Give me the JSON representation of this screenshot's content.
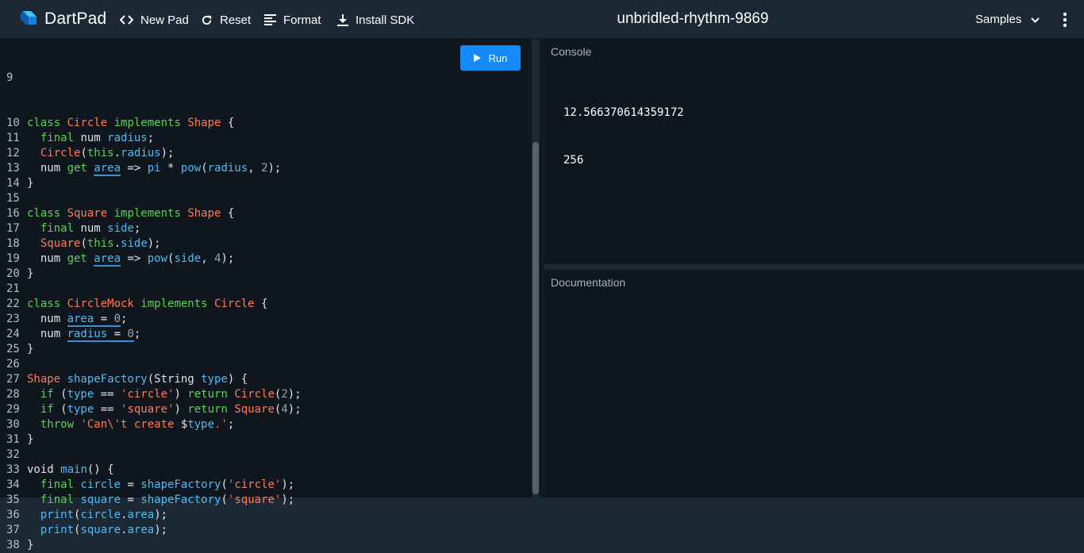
{
  "header": {
    "logo_text": "DartPad",
    "new_pad": "New Pad",
    "reset": "Reset",
    "format": "Format",
    "install_sdk": "Install SDK",
    "title": "unbridled-rhythm-9869",
    "samples": "Samples"
  },
  "editor": {
    "run_label": "Run",
    "first_line": "9",
    "lines": [
      {
        "n": "10",
        "t": [
          [
            "kw",
            "class "
          ],
          [
            "ty",
            "Circle"
          ],
          [
            "kw",
            " implements "
          ],
          [
            "ty",
            "Shape"
          ],
          [
            "pl",
            " {"
          ]
        ]
      },
      {
        "n": "11",
        "t": [
          [
            "pl",
            "  "
          ],
          [
            "kw",
            "final "
          ],
          [
            "pl",
            "num "
          ],
          [
            "fn",
            "radius"
          ],
          [
            "pl",
            ";"
          ]
        ]
      },
      {
        "n": "12",
        "t": [
          [
            "pl",
            "  "
          ],
          [
            "ty",
            "Circle"
          ],
          [
            "pl",
            "("
          ],
          [
            "kw",
            "this"
          ],
          [
            "pl",
            "."
          ],
          [
            "fn",
            "radius"
          ],
          [
            "pl",
            ");"
          ]
        ]
      },
      {
        "n": "13",
        "t": [
          [
            "pl",
            "  num "
          ],
          [
            "kw",
            "get "
          ],
          [
            "fn u",
            "area"
          ],
          [
            "pl",
            " => "
          ],
          [
            "fn",
            "pi"
          ],
          [
            "pl",
            " * "
          ],
          [
            "fn",
            "pow"
          ],
          [
            "pl",
            "("
          ],
          [
            "fn",
            "radius"
          ],
          [
            "pl",
            ", "
          ],
          [
            "nm",
            "2"
          ],
          [
            "pl",
            ");"
          ]
        ]
      },
      {
        "n": "14",
        "t": [
          [
            "pl",
            "}"
          ]
        ]
      },
      {
        "n": "15",
        "t": []
      },
      {
        "n": "16",
        "t": [
          [
            "kw",
            "class "
          ],
          [
            "ty",
            "Square"
          ],
          [
            "kw",
            " implements "
          ],
          [
            "ty",
            "Shape"
          ],
          [
            "pl",
            " {"
          ]
        ]
      },
      {
        "n": "17",
        "t": [
          [
            "pl",
            "  "
          ],
          [
            "kw",
            "final "
          ],
          [
            "pl",
            "num "
          ],
          [
            "fn",
            "side"
          ],
          [
            "pl",
            ";"
          ]
        ]
      },
      {
        "n": "18",
        "t": [
          [
            "pl",
            "  "
          ],
          [
            "ty",
            "Square"
          ],
          [
            "pl",
            "("
          ],
          [
            "kw",
            "this"
          ],
          [
            "pl",
            "."
          ],
          [
            "fn",
            "side"
          ],
          [
            "pl",
            ");"
          ]
        ]
      },
      {
        "n": "19",
        "t": [
          [
            "pl",
            "  num "
          ],
          [
            "kw",
            "get "
          ],
          [
            "fn u",
            "area"
          ],
          [
            "pl",
            " => "
          ],
          [
            "fn",
            "pow"
          ],
          [
            "pl",
            "("
          ],
          [
            "fn",
            "side"
          ],
          [
            "pl",
            ", "
          ],
          [
            "nm",
            "4"
          ],
          [
            "pl",
            ");"
          ]
        ]
      },
      {
        "n": "20",
        "t": [
          [
            "pl",
            "}"
          ]
        ]
      },
      {
        "n": "21",
        "t": []
      },
      {
        "n": "22",
        "t": [
          [
            "kw",
            "class "
          ],
          [
            "ty",
            "CircleMock"
          ],
          [
            "kw",
            " implements "
          ],
          [
            "ty",
            "Circle"
          ],
          [
            "pl",
            " {"
          ]
        ]
      },
      {
        "n": "23",
        "t": [
          [
            "pl",
            "  num "
          ],
          [
            "fn u",
            "area"
          ],
          [
            "pl u",
            " = "
          ],
          [
            "nm u",
            "0"
          ],
          [
            "pl",
            ";"
          ]
        ]
      },
      {
        "n": "24",
        "t": [
          [
            "pl",
            "  num "
          ],
          [
            "fn u",
            "radius"
          ],
          [
            "pl u",
            " = "
          ],
          [
            "nm u",
            "0"
          ],
          [
            "pl",
            ";"
          ]
        ]
      },
      {
        "n": "25",
        "t": [
          [
            "pl",
            "}"
          ]
        ]
      },
      {
        "n": "26",
        "t": []
      },
      {
        "n": "27",
        "t": [
          [
            "ty",
            "Shape "
          ],
          [
            "fn",
            "shapeFactory"
          ],
          [
            "pl",
            "(String "
          ],
          [
            "fn",
            "type"
          ],
          [
            "pl",
            ") {"
          ]
        ]
      },
      {
        "n": "28",
        "t": [
          [
            "pl",
            "  "
          ],
          [
            "kw",
            "if"
          ],
          [
            "pl",
            " ("
          ],
          [
            "fn",
            "type"
          ],
          [
            "pl",
            " == "
          ],
          [
            "st",
            "'circle'"
          ],
          [
            "pl",
            ") "
          ],
          [
            "kw",
            "return "
          ],
          [
            "ty",
            "Circle"
          ],
          [
            "pl",
            "("
          ],
          [
            "nm",
            "2"
          ],
          [
            "pl",
            ");"
          ]
        ]
      },
      {
        "n": "29",
        "t": [
          [
            "pl",
            "  "
          ],
          [
            "kw",
            "if"
          ],
          [
            "pl",
            " ("
          ],
          [
            "fn",
            "type"
          ],
          [
            "pl",
            " == "
          ],
          [
            "st",
            "'square'"
          ],
          [
            "pl",
            ") "
          ],
          [
            "kw",
            "return "
          ],
          [
            "ty",
            "Square"
          ],
          [
            "pl",
            "("
          ],
          [
            "nm",
            "4"
          ],
          [
            "pl",
            ");"
          ]
        ]
      },
      {
        "n": "30",
        "t": [
          [
            "pl",
            "  "
          ],
          [
            "kw",
            "throw "
          ],
          [
            "st",
            "'Can\\'t create "
          ],
          [
            "pl",
            "$"
          ],
          [
            "fn",
            "type"
          ],
          [
            "st",
            ".'"
          ],
          [
            "pl",
            ";"
          ]
        ]
      },
      {
        "n": "31",
        "t": [
          [
            "pl",
            "}"
          ]
        ]
      },
      {
        "n": "32",
        "t": []
      },
      {
        "n": "33",
        "t": [
          [
            "pl",
            "void "
          ],
          [
            "fn",
            "main"
          ],
          [
            "pl",
            "() {"
          ]
        ]
      },
      {
        "n": "34",
        "t": [
          [
            "pl",
            "  "
          ],
          [
            "kw",
            "final "
          ],
          [
            "fn",
            "circle"
          ],
          [
            "pl",
            " = "
          ],
          [
            "fn",
            "shapeFactory"
          ],
          [
            "pl",
            "("
          ],
          [
            "st",
            "'circle'"
          ],
          [
            "pl",
            ");"
          ]
        ]
      },
      {
        "n": "35",
        "t": [
          [
            "pl",
            "  "
          ],
          [
            "kw",
            "final "
          ],
          [
            "fn",
            "square"
          ],
          [
            "pl",
            " = "
          ],
          [
            "fn",
            "shapeFactory"
          ],
          [
            "pl",
            "("
          ],
          [
            "st",
            "'square'"
          ],
          [
            "pl",
            ");"
          ]
        ]
      },
      {
        "n": "36",
        "t": [
          [
            "pl",
            "  "
          ],
          [
            "fn",
            "print"
          ],
          [
            "pl",
            "("
          ],
          [
            "fn",
            "circle"
          ],
          [
            "pl",
            "."
          ],
          [
            "fn",
            "area"
          ],
          [
            "pl",
            ");"
          ]
        ]
      },
      {
        "n": "37",
        "t": [
          [
            "pl",
            "  "
          ],
          [
            "fn",
            "print"
          ],
          [
            "pl",
            "("
          ],
          [
            "fn",
            "square"
          ],
          [
            "pl",
            "."
          ],
          [
            "fn",
            "area"
          ],
          [
            "pl",
            ");"
          ]
        ]
      },
      {
        "n": "38",
        "t": [
          [
            "pl",
            "}"
          ]
        ]
      }
    ]
  },
  "console": {
    "label": "Console",
    "output": [
      "12.566370614359172",
      "256"
    ]
  },
  "docs": {
    "label": "Documentation"
  },
  "colors": {
    "background": "#0f161d",
    "chrome": "#1c2834",
    "run_button": "#168afd",
    "keyword": "#5bd15b",
    "type": "#ff7b58",
    "identifier": "#4fbbf4"
  },
  "icons": {
    "logo": "dart-logo-icon",
    "new_pad": "code-brackets-icon",
    "reset": "refresh-icon",
    "format": "format-lines-icon",
    "install_sdk": "download-icon",
    "samples": "chevron-down-icon",
    "more": "more-vertical-icon",
    "run": "play-icon"
  }
}
